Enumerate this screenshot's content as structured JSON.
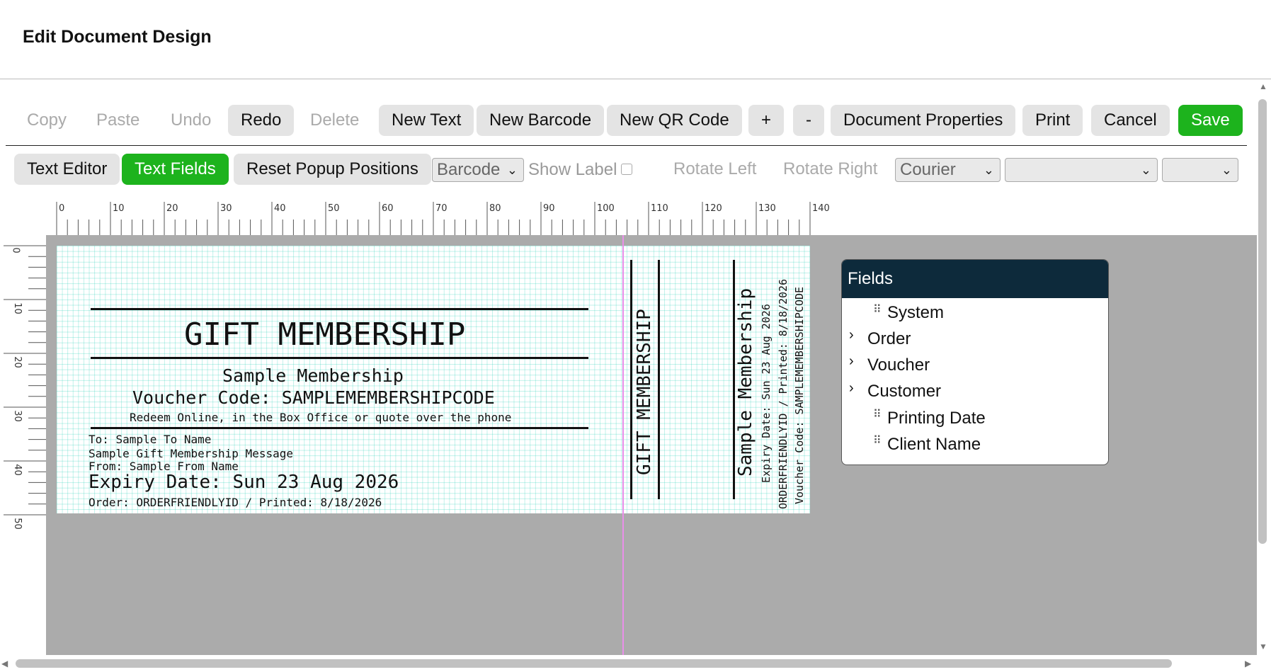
{
  "header": {
    "title": "Edit Document Design"
  },
  "toolbar": {
    "copy": "Copy",
    "paste": "Paste",
    "undo": "Undo",
    "redo": "Redo",
    "delete": "Delete",
    "new_text": "New Text",
    "new_barcode": "New Barcode",
    "new_qr": "New QR Code",
    "plus": "+",
    "minus": "-",
    "doc_props": "Document Properties",
    "print": "Print",
    "cancel": "Cancel",
    "save": "Save",
    "text_editor": "Text Editor",
    "text_fields": "Text Fields",
    "reset_popup": "Reset Popup Positions",
    "barcode_select": "Barcode",
    "show_label": "Show Label",
    "rotate_left": "Rotate Left",
    "rotate_right": "Rotate Right",
    "font_select": "Courier",
    "size_select": "",
    "style_select": ""
  },
  "ruler": {
    "h": [
      "0",
      "10",
      "20",
      "30",
      "40",
      "50",
      "60",
      "70",
      "80",
      "90",
      "100",
      "110",
      "120",
      "130",
      "140"
    ],
    "v": [
      "0",
      "10",
      "20",
      "30",
      "40",
      "50"
    ]
  },
  "document": {
    "title": "GIFT MEMBERSHIP",
    "subtitle": "Sample Membership",
    "voucher": "Voucher Code: SAMPLEMEMBERSHIPCODE",
    "redeem": "Redeem Online, in the Box Office or quote over the phone",
    "to": "To: Sample To Name",
    "message": "Sample Gift Membership Message",
    "from": "From: Sample From Name",
    "expiry": "Expiry Date: Sun 23 Aug 2026",
    "order": "Order: ORDERFRIENDLYID / Printed: 8/18/2026",
    "stub_title": "GIFT MEMBERSHIP",
    "stub_name": "Sample Membership",
    "stub_expiry": "Expiry Date: Sun 23 Aug 2026",
    "stub_order": "ORDERFRIENDLYID / Printed: 8/18/2026",
    "stub_voucher": "Voucher Code: SAMPLEMEMBERSHIPCODE"
  },
  "fields": {
    "title": "Fields",
    "items": [
      {
        "label": "System",
        "kind": "drag"
      },
      {
        "label": "Order",
        "kind": "expand"
      },
      {
        "label": "Voucher",
        "kind": "expand"
      },
      {
        "label": "Customer",
        "kind": "expand"
      },
      {
        "label": "Printing Date",
        "kind": "drag"
      },
      {
        "label": "Client Name",
        "kind": "drag"
      }
    ]
  },
  "colors": {
    "accent_green": "#1db31d",
    "panel_header": "#0d2a3b",
    "canvas_bg": "#ababab"
  }
}
